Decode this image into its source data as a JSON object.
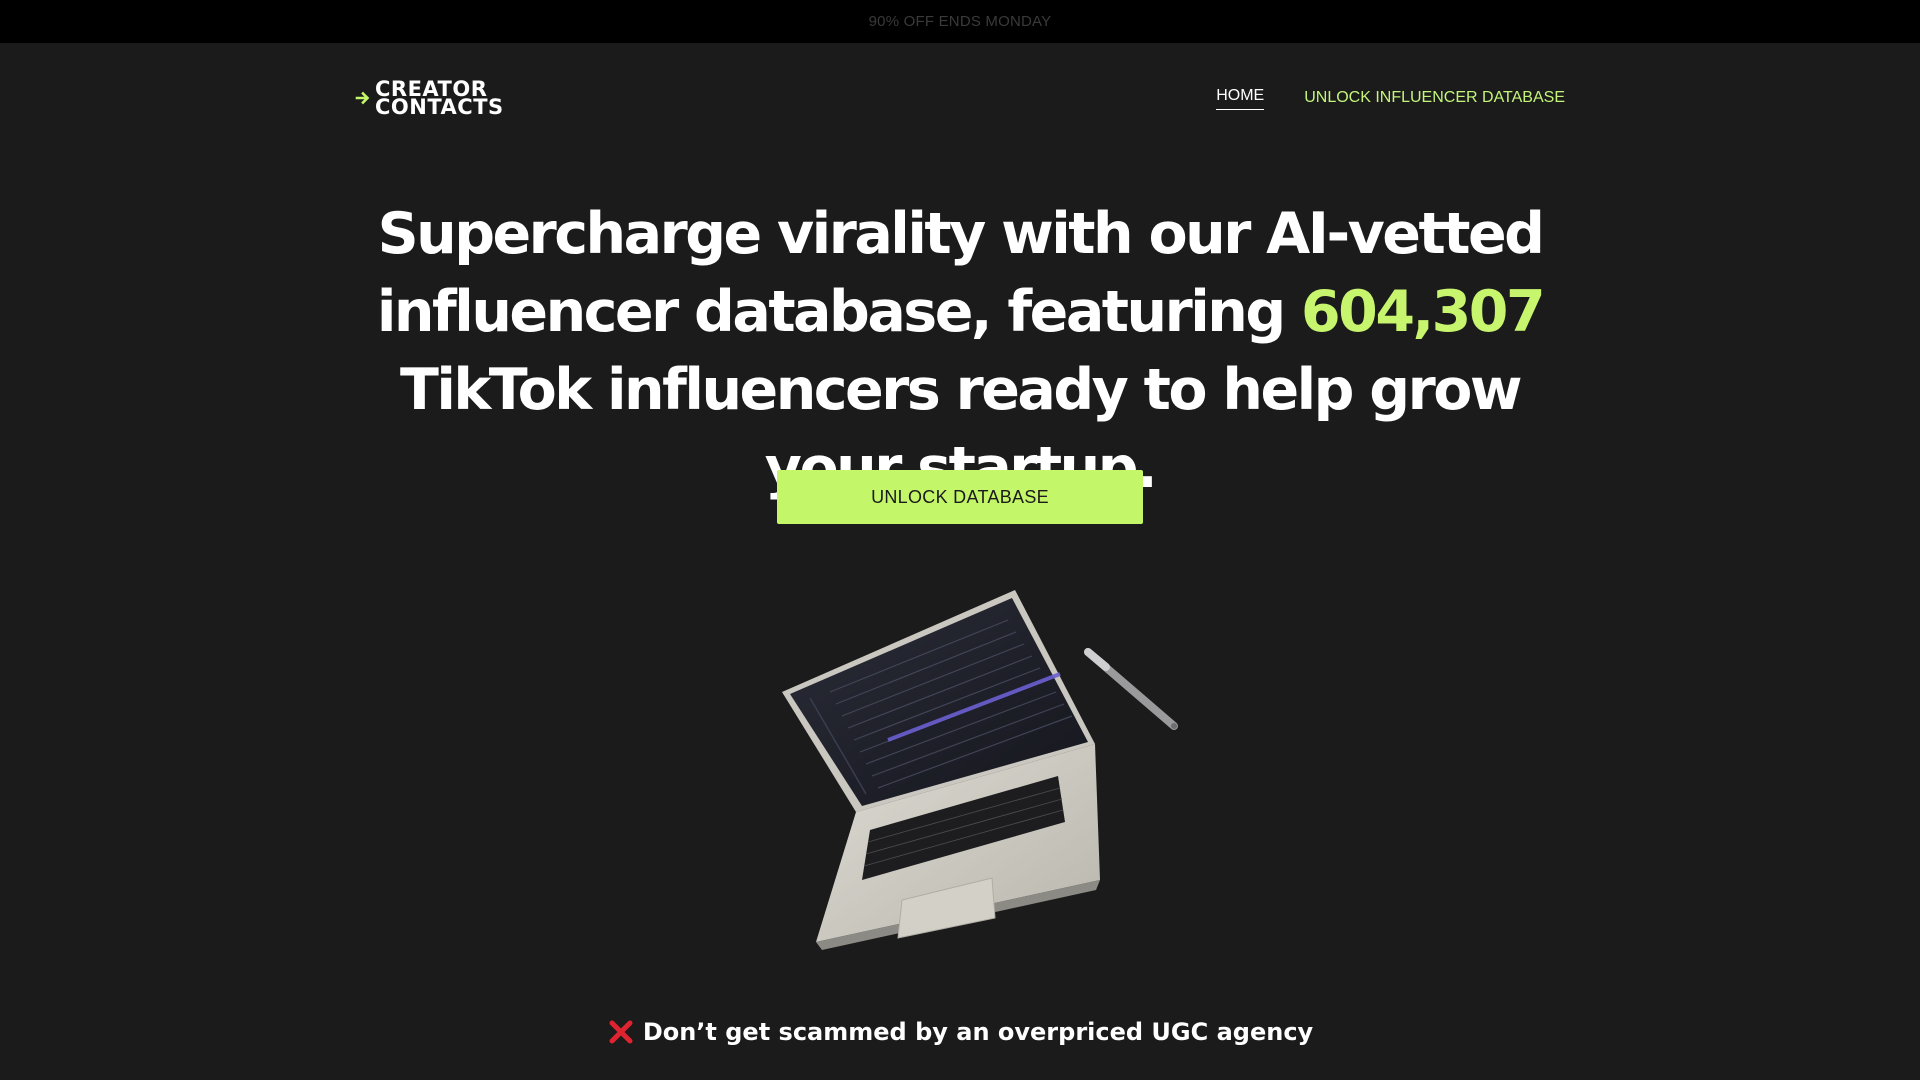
{
  "announcement": {
    "text": "90% OFF ENDS MONDAY"
  },
  "logo": {
    "line1": "CREATOR",
    "line2": "CONTACTS",
    "icon": "arrow-right-icon"
  },
  "nav": {
    "home_label": "HOME",
    "unlock_label": "UNLOCK INFLUENCER DATABASE"
  },
  "hero": {
    "part1": "Supercharge virality with our AI-vetted influencer database, featuring ",
    "count": "604,307",
    "part2": " TikTok influencers ready to help grow your startup."
  },
  "cta": {
    "label": "UNLOCK DATABASE"
  },
  "notice": {
    "icon": "red-x-icon",
    "text": "Don’t get scammed by an overpriced UGC agency"
  },
  "colors": {
    "accent": "#c4f66a",
    "background": "#1b1b1b",
    "topbar": "#000000",
    "warning": "#e0242f"
  }
}
